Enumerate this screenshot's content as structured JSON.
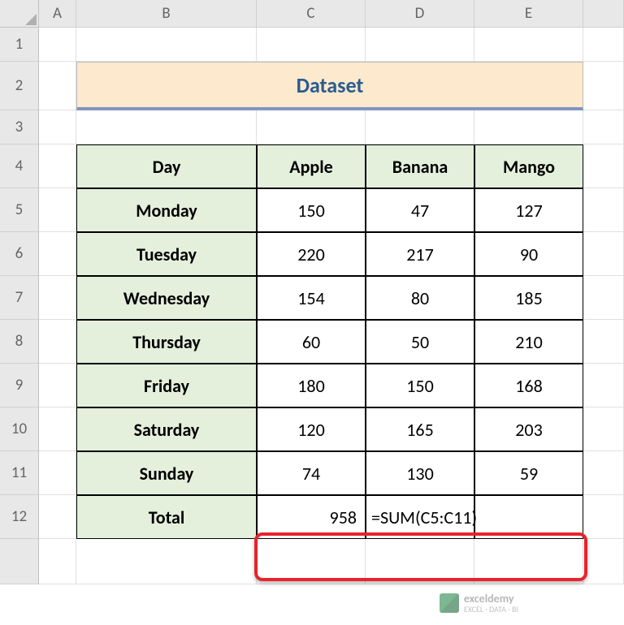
{
  "columns": [
    "A",
    "B",
    "C",
    "D",
    "E"
  ],
  "rows": [
    "1",
    "2",
    "3",
    "4",
    "5",
    "6",
    "7",
    "8",
    "9",
    "10",
    "11",
    "12"
  ],
  "title": "Dataset",
  "table": {
    "headers": [
      "Day",
      "Apple",
      "Banana",
      "Mango"
    ],
    "data": [
      {
        "day": "Monday",
        "apple": "150",
        "banana": "47",
        "mango": "127"
      },
      {
        "day": "Tuesday",
        "apple": "220",
        "banana": "217",
        "mango": "90"
      },
      {
        "day": "Wednesday",
        "apple": "154",
        "banana": "80",
        "mango": "185"
      },
      {
        "day": "Thursday",
        "apple": "60",
        "banana": "50",
        "mango": "210"
      },
      {
        "day": "Friday",
        "apple": "180",
        "banana": "150",
        "mango": "168"
      },
      {
        "day": "Saturday",
        "apple": "120",
        "banana": "165",
        "mango": "203"
      },
      {
        "day": "Sunday",
        "apple": "74",
        "banana": "130",
        "mango": "59"
      }
    ],
    "total_label": "Total",
    "total_value": "958",
    "formula": "=SUM(C5:C11)"
  },
  "watermark": {
    "brand": "exceldemy",
    "tagline": "EXCEL · DATA · BI"
  }
}
